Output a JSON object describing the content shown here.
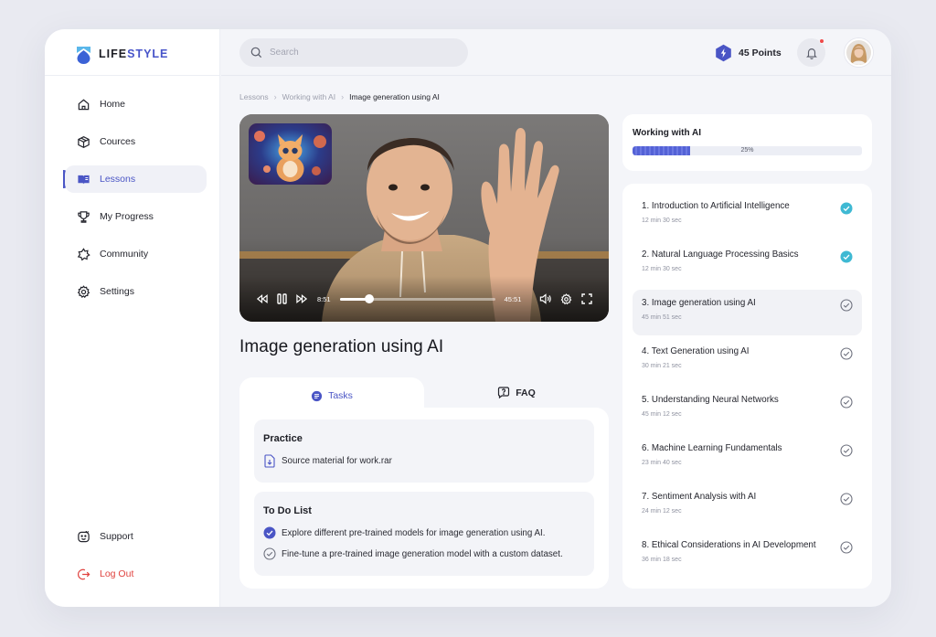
{
  "brand": {
    "name_part1": "LIFE",
    "name_part2": "STYLE",
    "logo_color": "#3b8fe6"
  },
  "sidebar": {
    "items": [
      {
        "label": "Home",
        "icon": "home-icon"
      },
      {
        "label": "Cources",
        "icon": "box-icon"
      },
      {
        "label": "Lessons",
        "icon": "book-icon",
        "active": true
      },
      {
        "label": "My Progress",
        "icon": "trophy-icon"
      },
      {
        "label": "Community",
        "icon": "star-badge-icon"
      },
      {
        "label": "Settings",
        "icon": "gear-icon"
      }
    ],
    "support_label": "Support",
    "logout_label": "Log Out"
  },
  "header": {
    "search_placeholder": "Search",
    "points_label": "45 Points"
  },
  "breadcrumb": [
    "Lessons",
    "Working with AI",
    "Image generation using AI"
  ],
  "video": {
    "current_time": "8:51",
    "total_time": "45:51",
    "progress": 0.19
  },
  "lesson_title": "Image generation using AI",
  "tabs": {
    "tasks_label": "Tasks",
    "faq_label": "FAQ"
  },
  "practice": {
    "title": "Practice",
    "file": "Source material for work.rar"
  },
  "todo": {
    "title": "To Do List",
    "items": [
      {
        "text": "Explore different pre-trained models for image generation using AI.",
        "done": true
      },
      {
        "text": "Fine-tune a pre-trained image generation model with a custom dataset.",
        "done": false
      }
    ]
  },
  "course_progress": {
    "title": "Working with AI",
    "percent_label": "25%",
    "percent": 0.25
  },
  "lessons": [
    {
      "title": "1. Introduction to Artificial Intelligence",
      "duration": "12 min 30 sec",
      "status": "completed"
    },
    {
      "title": "2. Natural Language Processing Basics",
      "duration": "12 min 30 sec",
      "status": "completed"
    },
    {
      "title": "3. Image generation using AI",
      "duration": "45 min 51 sec",
      "status": "current"
    },
    {
      "title": "4. Text Generation using AI",
      "duration": "30 min 21 sec",
      "status": "pending"
    },
    {
      "title": "5. Understanding Neural Networks",
      "duration": "45 min 12 sec",
      "status": "pending"
    },
    {
      "title": "6. Machine Learning Fundamentals",
      "duration": "23 min 40 sec",
      "status": "pending"
    },
    {
      "title": "7. Sentiment Analysis with AI",
      "duration": "24 min 12 sec",
      "status": "pending"
    },
    {
      "title": "8. Ethical Considerations in AI Development",
      "duration": "36 min 18 sec",
      "status": "pending"
    }
  ],
  "colors": {
    "accent": "#4a55c5",
    "check": "#3fb9d3",
    "logout": "#e0433f"
  }
}
